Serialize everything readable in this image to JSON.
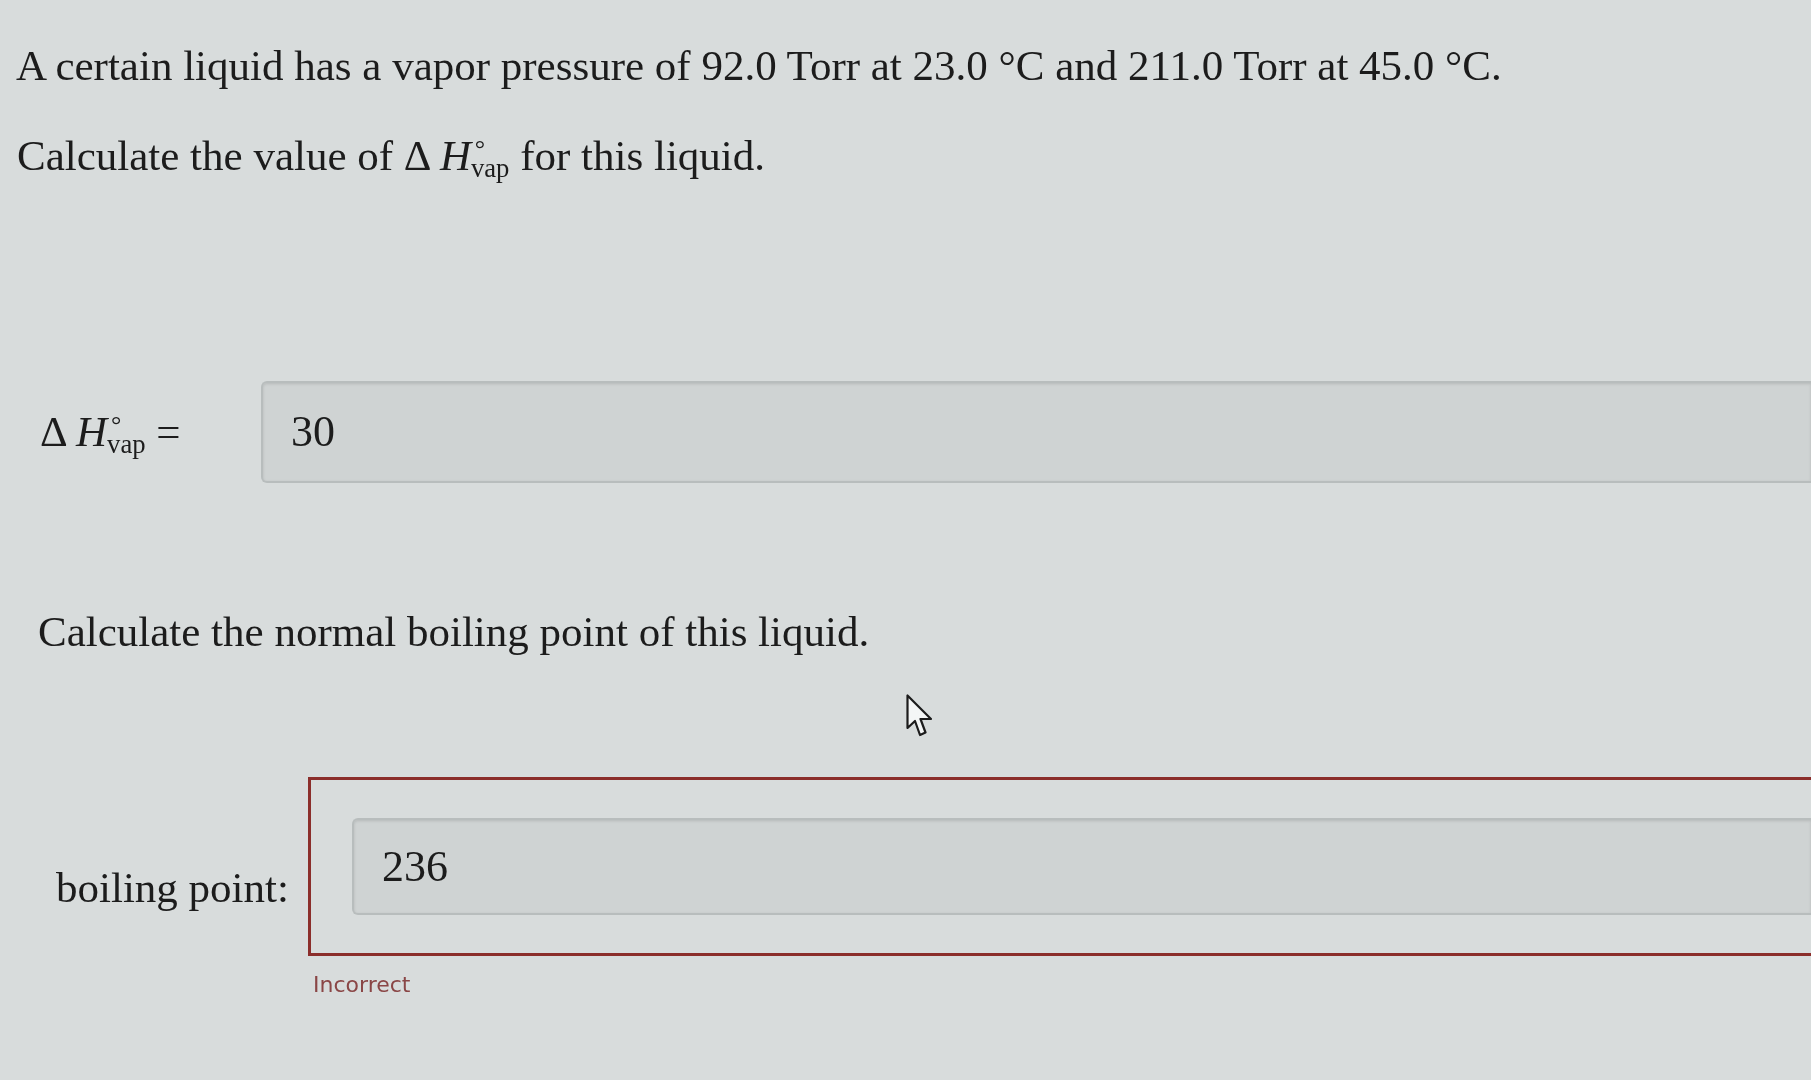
{
  "question": {
    "prompt": "A certain liquid has a vapor pressure of 92.0 Torr at 23.0 °C and 211.0 Torr at 45.0 °C.",
    "parts": [
      {
        "kind": "inline",
        "instruction": "Calculate the value of Δ *H*$^{°}$$_{vap}$ for this liquid.",
        "label": "Δ *H*$^{°}$$_{vap}$ =",
        "value": "30"
      },
      {
        "kind": "framed",
        "instruction": "Calculate the normal boiling point of this liquid.",
        "label": "boiling point:",
        "value": "236",
        "incorrect": true,
        "feedback": "Incorrect"
      }
    ]
  }
}
